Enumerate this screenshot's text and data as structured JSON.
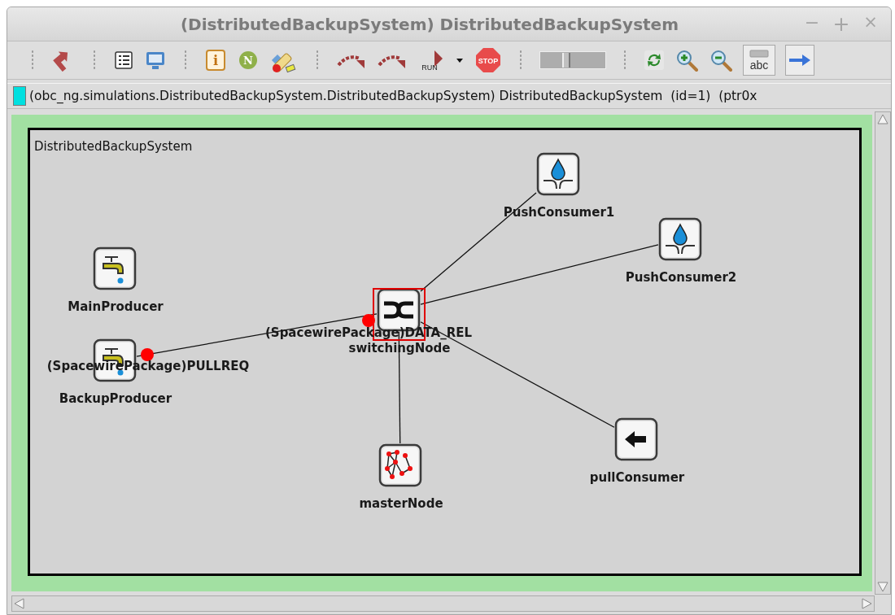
{
  "window": {
    "title": "(DistributedBackupSystem) DistributedBackupSystem",
    "controls": [
      {
        "kind": "minimize",
        "label": "−"
      },
      {
        "kind": "maximize",
        "label": "+"
      },
      {
        "kind": "close",
        "label": "×"
      }
    ]
  },
  "toolbar": [
    {
      "kind": "grip"
    },
    {
      "kind": "up"
    },
    {
      "kind": "grip"
    },
    {
      "kind": "list"
    },
    {
      "kind": "monitor"
    },
    {
      "kind": "grip"
    },
    {
      "kind": "info",
      "label": "i"
    },
    {
      "kind": "badge",
      "label": "N"
    },
    {
      "kind": "tool"
    },
    {
      "kind": "grip"
    },
    {
      "kind": "step"
    },
    {
      "kind": "step"
    },
    {
      "kind": "run",
      "label": "RUN"
    },
    {
      "kind": "caret"
    },
    {
      "kind": "stop",
      "label": "STOP"
    },
    {
      "kind": "grip"
    },
    {
      "kind": "slider",
      "level": 0.38
    },
    {
      "kind": "grip"
    },
    {
      "kind": "refresh"
    },
    {
      "kind": "zoomin"
    },
    {
      "kind": "zoomout"
    },
    {
      "kind": "abc",
      "label": "abc",
      "pressed": true
    },
    {
      "kind": "arrow",
      "pressed": true
    }
  ],
  "info_bar": {
    "color": "#00e0e0",
    "text": "(obc_ng.simulations.DistributedBackupSystem.DistributedBackupSystem) DistributedBackupSystem  (id=1)  (ptr0x"
  },
  "canvas": {
    "module_title": "DistributedBackupSystem",
    "nodes": [
      {
        "name": "PushConsumer1",
        "kind": "sink",
        "selected": false
      },
      {
        "name": "PushConsumer2",
        "kind": "sink",
        "selected": false
      },
      {
        "name": "MainProducer",
        "kind": "source",
        "selected": false
      },
      {
        "name": "BackupProducer",
        "kind": "source",
        "selected": false
      },
      {
        "name": "switchingNode",
        "kind": "switch",
        "selected": true
      },
      {
        "name": "masterNode",
        "kind": "network",
        "selected": false
      },
      {
        "name": "pullConsumer",
        "kind": "pull",
        "selected": false
      }
    ],
    "messages": [
      {
        "label": "(SpacewirePackage)DATA_REL"
      },
      {
        "label": "(SpacewirePackage)PULLREQ"
      }
    ]
  }
}
